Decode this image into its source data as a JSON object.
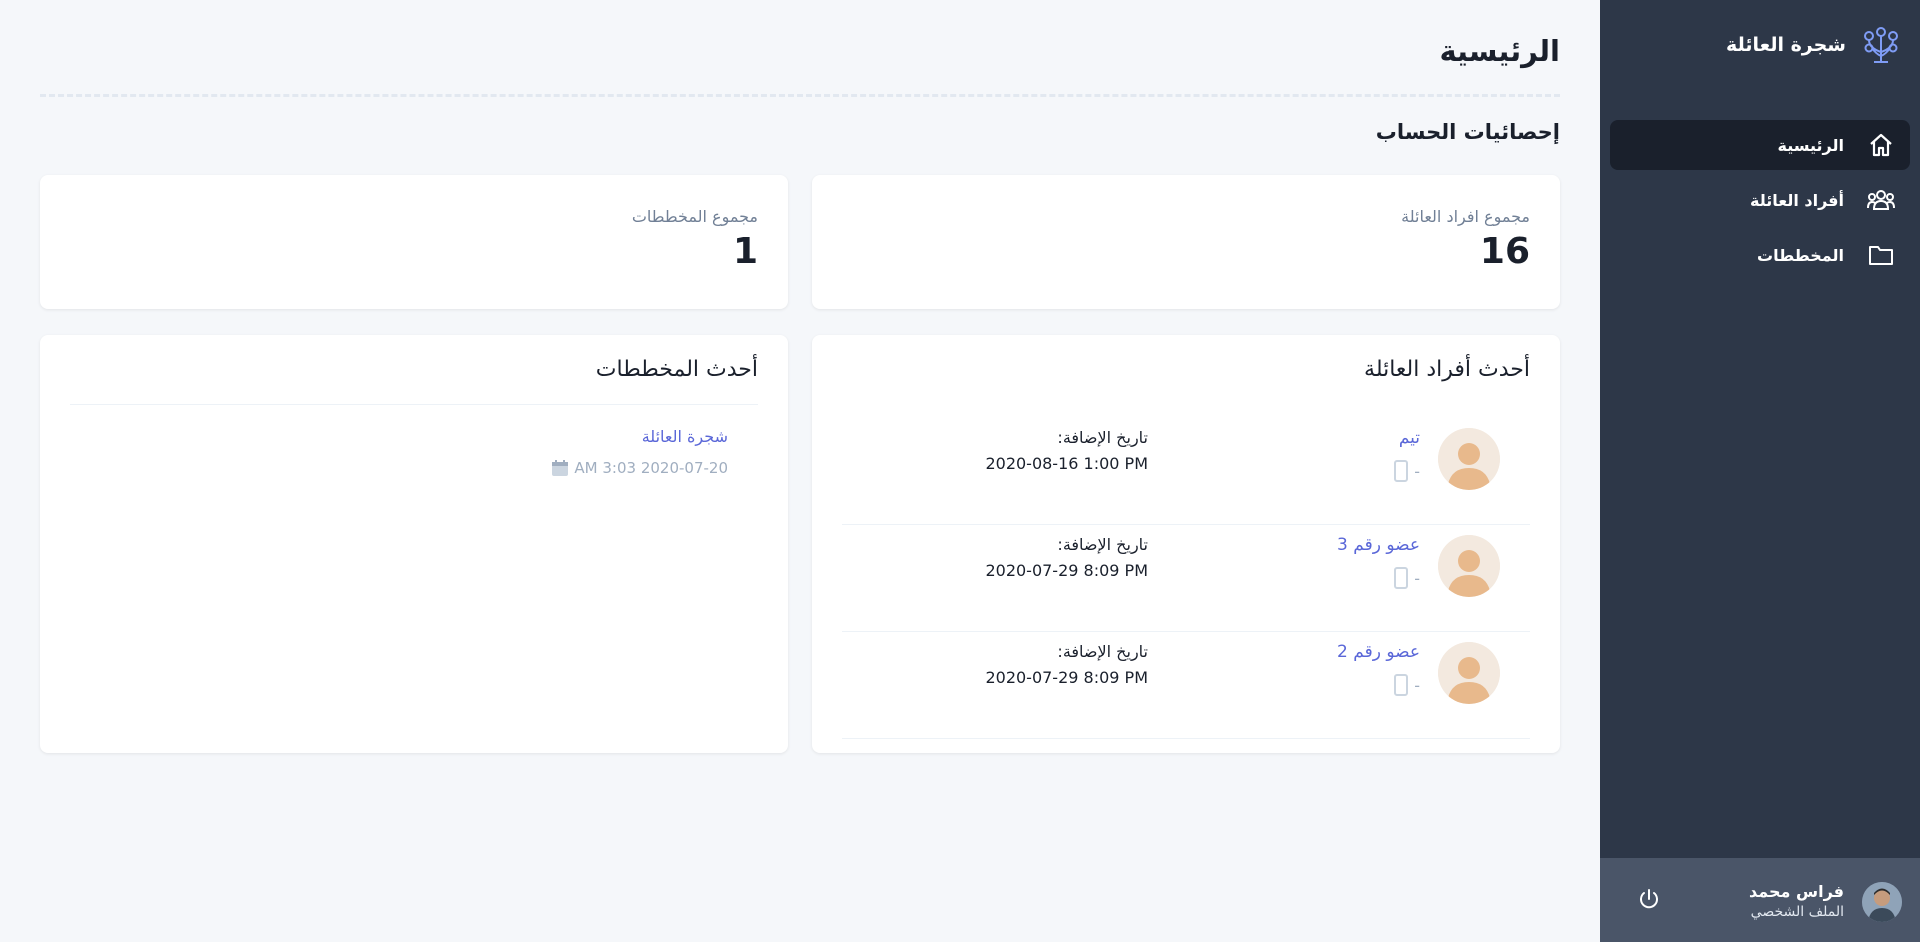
{
  "app": {
    "brand_title": "شجرة العائلة"
  },
  "sidebar": {
    "items": [
      {
        "label": "الرئيسية",
        "icon": "home-icon",
        "active": true
      },
      {
        "label": "أفراد العائلة",
        "icon": "users-icon",
        "active": false
      },
      {
        "label": "المخططات",
        "icon": "folder-icon",
        "active": false
      }
    ],
    "user": {
      "name": "فراس محمد",
      "profile_link": "الملف الشخصي"
    }
  },
  "main": {
    "page_title": "الرئيسية",
    "section_title": "إحصائيات الحساب",
    "stats": {
      "family_members_label": "مجموع افراد العائلة",
      "family_members_value": "16",
      "charts_label": "مجموع المخططات",
      "charts_value": "1"
    },
    "latest_members": {
      "title": "أحدث أفراد العائلة",
      "items": [
        {
          "name": "تيم",
          "sub": "-",
          "date_label": "تاريخ الإضافة:",
          "date": "2020-08-16 1:00 PM"
        },
        {
          "name": "عضو رقم 3",
          "sub": "-",
          "date_label": "تاريخ الإضافة:",
          "date": "2020-07-29 8:09 PM"
        },
        {
          "name": "عضو رقم 2",
          "sub": "-",
          "date_label": "تاريخ الإضافة:",
          "date": "2020-07-29 8:09 PM"
        }
      ]
    },
    "latest_charts": {
      "title": "أحدث المخططات",
      "items": [
        {
          "name": "شجرة العائلة",
          "date": "AM 3:03 2020-07-20"
        }
      ]
    }
  },
  "colors": {
    "sidebar_bg": "#2d3748",
    "sidebar_active_bg": "#1a202c",
    "user_bar_bg": "#4a5568",
    "accent": "#5a67d8",
    "page_bg": "#f5f7fa",
    "brand_icon": "#7f9cf5"
  }
}
